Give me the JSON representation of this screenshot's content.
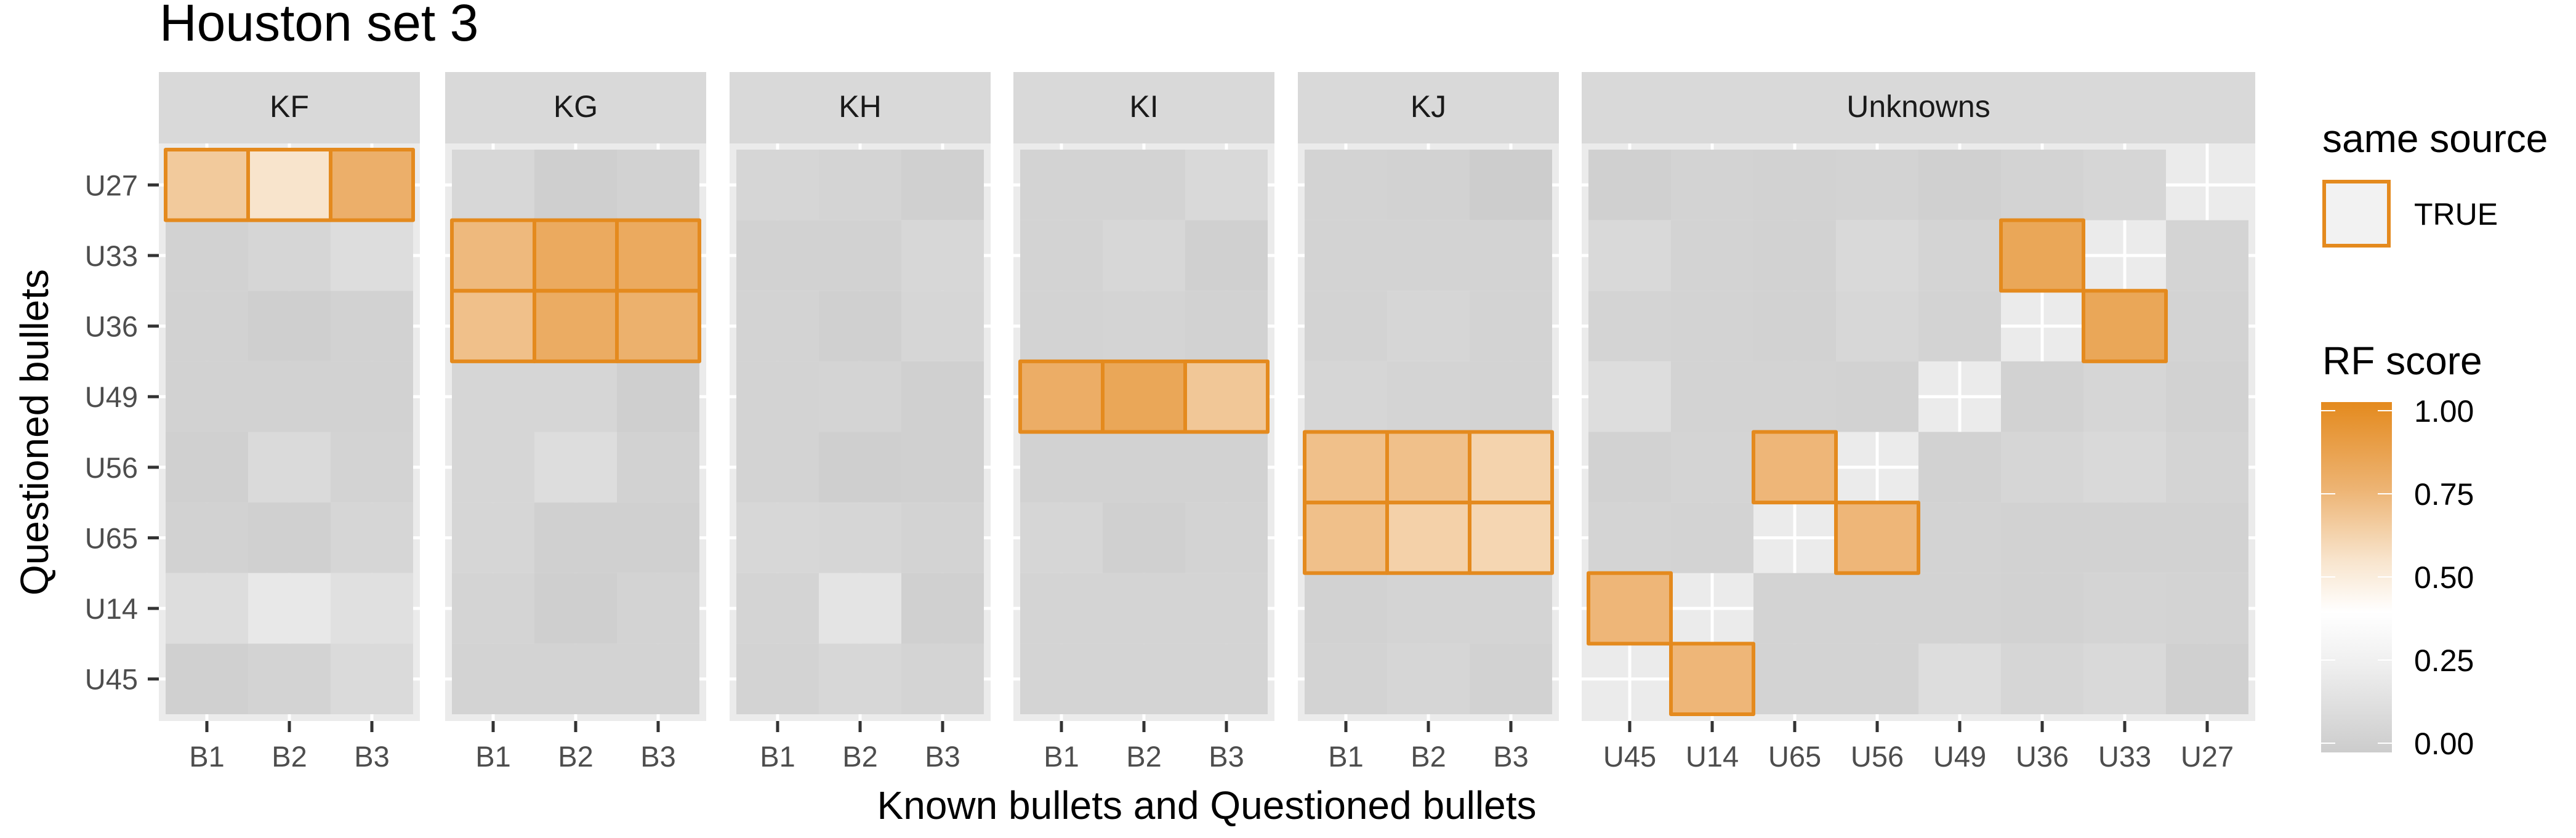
{
  "chart_data": {
    "type": "heatmap",
    "title": "Houston set 3",
    "xlabel": "Known bullets and Questioned bullets",
    "ylabel": "Questioned bullets",
    "rows": [
      "U27",
      "U33",
      "U36",
      "U49",
      "U56",
      "U65",
      "U14",
      "U45"
    ],
    "panels": [
      {
        "name": "KF",
        "columns": [
          "B1",
          "B2",
          "B3"
        ],
        "values": [
          [
            0.66,
            0.55,
            0.78
          ],
          [
            0.04,
            0.07,
            0.12
          ],
          [
            0.04,
            0.02,
            0.04
          ],
          [
            0.04,
            0.04,
            0.04
          ],
          [
            0.03,
            0.1,
            0.05
          ],
          [
            0.04,
            0.03,
            0.07
          ],
          [
            0.12,
            0.2,
            0.14
          ],
          [
            0.03,
            0.05,
            0.1
          ]
        ],
        "same_source": [
          [
            true,
            true,
            true
          ],
          [
            false,
            false,
            false
          ],
          [
            false,
            false,
            false
          ],
          [
            false,
            false,
            false
          ],
          [
            false,
            false,
            false
          ],
          [
            false,
            false,
            false
          ],
          [
            false,
            false,
            false
          ],
          [
            false,
            false,
            false
          ]
        ]
      },
      {
        "name": "KG",
        "columns": [
          "B1",
          "B2",
          "B3"
        ],
        "values": [
          [
            0.08,
            0.02,
            0.04
          ],
          [
            0.73,
            0.81,
            0.81
          ],
          [
            0.7,
            0.8,
            0.77
          ],
          [
            0.07,
            0.07,
            0.02
          ],
          [
            0.07,
            0.12,
            0.04
          ],
          [
            0.07,
            0.03,
            0.03
          ],
          [
            0.06,
            0.02,
            0.05
          ],
          [
            0.05,
            0.05,
            0.05
          ]
        ],
        "same_source": [
          [
            false,
            false,
            false
          ],
          [
            true,
            true,
            true
          ],
          [
            true,
            true,
            true
          ],
          [
            false,
            false,
            false
          ],
          [
            false,
            false,
            false
          ],
          [
            false,
            false,
            false
          ],
          [
            false,
            false,
            false
          ],
          [
            false,
            false,
            false
          ]
        ]
      },
      {
        "name": "KH",
        "columns": [
          "B1",
          "B2",
          "B3"
        ],
        "values": [
          [
            0.07,
            0.06,
            0.03
          ],
          [
            0.04,
            0.04,
            0.08
          ],
          [
            0.05,
            0.03,
            0.07
          ],
          [
            0.05,
            0.06,
            0.03
          ],
          [
            0.05,
            0.02,
            0.03
          ],
          [
            0.08,
            0.07,
            0.05
          ],
          [
            0.06,
            0.17,
            0.03
          ],
          [
            0.05,
            0.08,
            0.06
          ]
        ],
        "same_source": [
          [
            false,
            false,
            false
          ],
          [
            false,
            false,
            false
          ],
          [
            false,
            false,
            false
          ],
          [
            false,
            false,
            false
          ],
          [
            false,
            false,
            false
          ],
          [
            false,
            false,
            false
          ],
          [
            false,
            false,
            false
          ],
          [
            false,
            false,
            false
          ]
        ]
      },
      {
        "name": "KI",
        "columns": [
          "B1",
          "B2",
          "B3"
        ],
        "values": [
          [
            0.05,
            0.05,
            0.09
          ],
          [
            0.05,
            0.08,
            0.03
          ],
          [
            0.05,
            0.06,
            0.04
          ],
          [
            0.79,
            0.83,
            0.67
          ],
          [
            0.04,
            0.04,
            0.04
          ],
          [
            0.07,
            0.03,
            0.05
          ],
          [
            0.06,
            0.06,
            0.06
          ],
          [
            0.06,
            0.06,
            0.06
          ]
        ],
        "same_source": [
          [
            false,
            false,
            false
          ],
          [
            false,
            false,
            false
          ],
          [
            false,
            false,
            false
          ],
          [
            true,
            true,
            true
          ],
          [
            false,
            false,
            false
          ],
          [
            false,
            false,
            false
          ],
          [
            false,
            false,
            false
          ],
          [
            false,
            false,
            false
          ]
        ]
      },
      {
        "name": "KJ",
        "columns": [
          "B1",
          "B2",
          "B3"
        ],
        "values": [
          [
            0.05,
            0.04,
            0.01
          ],
          [
            0.05,
            0.05,
            0.05
          ],
          [
            0.05,
            0.07,
            0.05
          ],
          [
            0.07,
            0.06,
            0.05
          ],
          [
            0.7,
            0.7,
            0.62
          ],
          [
            0.7,
            0.63,
            0.61
          ],
          [
            0.04,
            0.06,
            0.06
          ],
          [
            0.05,
            0.07,
            0.04
          ]
        ],
        "same_source": [
          [
            false,
            false,
            false
          ],
          [
            false,
            false,
            false
          ],
          [
            false,
            false,
            false
          ],
          [
            false,
            false,
            false
          ],
          [
            true,
            true,
            true
          ],
          [
            true,
            true,
            true
          ],
          [
            false,
            false,
            false
          ],
          [
            false,
            false,
            false
          ]
        ]
      },
      {
        "name": "Unknowns",
        "columns": [
          "U45",
          "U14",
          "U65",
          "U56",
          "U49",
          "U36",
          "U33",
          "U27"
        ],
        "values": [
          [
            0.03,
            0.05,
            0.04,
            0.05,
            0.03,
            0.05,
            0.07,
            null
          ],
          [
            0.09,
            0.05,
            0.04,
            0.09,
            0.06,
            0.83,
            null,
            0.06
          ],
          [
            0.06,
            0.05,
            0.04,
            0.08,
            0.05,
            null,
            0.83,
            0.05
          ],
          [
            0.12,
            0.05,
            0.05,
            0.04,
            null,
            0.04,
            0.07,
            0.04
          ],
          [
            0.04,
            0.06,
            0.74,
            null,
            0.04,
            0.07,
            0.09,
            0.06
          ],
          [
            0.06,
            0.05,
            null,
            0.74,
            0.05,
            0.04,
            0.04,
            0.04
          ],
          [
            0.74,
            null,
            0.05,
            0.05,
            0.05,
            0.04,
            0.06,
            0.05
          ],
          [
            null,
            0.74,
            0.05,
            0.05,
            0.12,
            0.07,
            0.09,
            0.03
          ]
        ],
        "same_source": [
          [
            false,
            false,
            false,
            false,
            false,
            false,
            false,
            false
          ],
          [
            false,
            false,
            false,
            false,
            false,
            true,
            false,
            false
          ],
          [
            false,
            false,
            false,
            false,
            false,
            false,
            true,
            false
          ],
          [
            false,
            false,
            false,
            false,
            false,
            false,
            false,
            false
          ],
          [
            false,
            false,
            true,
            false,
            false,
            false,
            false,
            false
          ],
          [
            false,
            false,
            false,
            true,
            false,
            false,
            false,
            false
          ],
          [
            true,
            false,
            false,
            false,
            false,
            false,
            false,
            false
          ],
          [
            false,
            true,
            false,
            false,
            false,
            false,
            false,
            false
          ]
        ]
      }
    ],
    "color_scale": {
      "title": "RF score",
      "range": [
        0,
        1
      ],
      "ticks": [
        "1.00",
        "0.75",
        "0.50",
        "0.25",
        "0.00"
      ],
      "tick_values": [
        1.0,
        0.75,
        0.5,
        0.25,
        0.0
      ],
      "low_color": "#cccccc",
      "mid_color": "#ffffff",
      "high_color": "#e48a1e"
    },
    "outline_legend": {
      "title": "same source",
      "label": "TRUE",
      "outline_color": "#e48a1e"
    },
    "grid": true,
    "legend_position": "right"
  }
}
